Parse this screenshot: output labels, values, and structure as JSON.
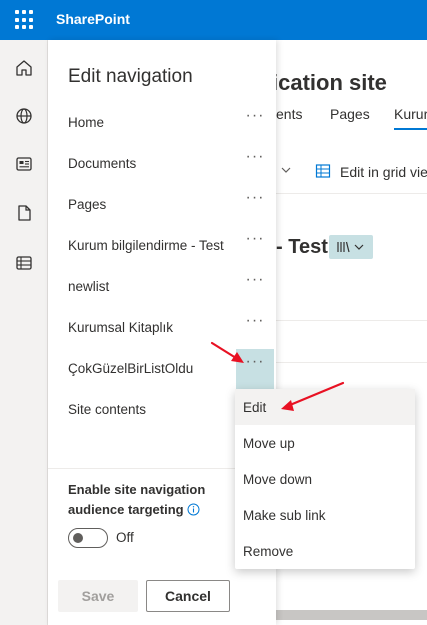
{
  "suite": {
    "brand": "SharePoint"
  },
  "rail": {
    "icons": [
      "home-icon",
      "globe-icon",
      "news-icon",
      "document-icon",
      "lists-icon"
    ]
  },
  "background": {
    "site_title": "ication site",
    "tabs": [
      "ents",
      "Pages",
      "Kurur"
    ],
    "grid_label": "Edit in grid vie",
    "list_title": "- Test"
  },
  "panel": {
    "title": "Edit navigation",
    "items": [
      {
        "label": "Home",
        "more": "···"
      },
      {
        "label": "Documents",
        "more": "···"
      },
      {
        "label": "Pages",
        "more": "···"
      },
      {
        "label": "Kurum bilgilendirme - Test",
        "more": "···"
      },
      {
        "label": "newlist",
        "more": "···"
      },
      {
        "label": "Kurumsal Kitaplık",
        "more": "···"
      },
      {
        "label": "ÇokGüzelBirListOldu",
        "more": "···"
      },
      {
        "label": "Site contents"
      }
    ],
    "audience_label": "Enable site navigation audience targeting",
    "toggle_label": "Off",
    "toggle_on": false,
    "save_label": "Save",
    "cancel_label": "Cancel"
  },
  "context_menu": {
    "items": [
      "Edit",
      "Move up",
      "Move down",
      "Make sub link",
      "Remove"
    ],
    "highlighted": "Edit"
  },
  "colors": {
    "suite_bar": "#0078d4",
    "active_more_button": "#c7e0e3",
    "annotation_arrow": "#e81123"
  }
}
